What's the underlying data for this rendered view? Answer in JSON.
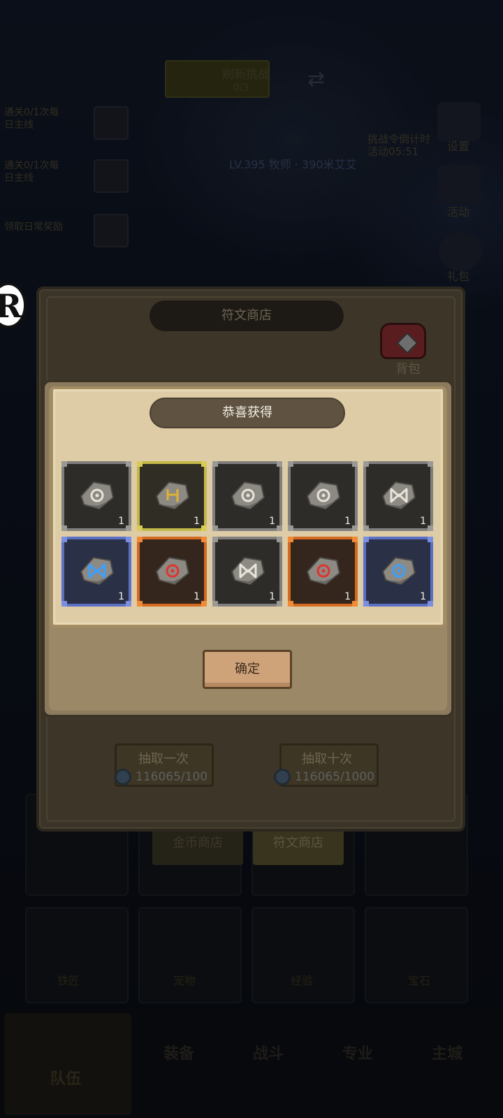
{
  "background": {
    "hp_text": "刷新挑战",
    "hp_sub": "0/3",
    "quests": [
      {
        "line1": "通关0/1次每",
        "line2": "日主线"
      },
      {
        "line1": "通关0/1次每",
        "line2": "日主线"
      },
      {
        "line1": "领取日常奖励",
        "line2": ""
      }
    ],
    "level_line": "LV.395 牧师 · 390米艾艾",
    "right_menu": [
      "设置",
      "活动",
      "礼包"
    ],
    "timer_text": "挑战令倒计时 活动05:51",
    "shop_tabs": [
      "金币商店",
      "符文商店"
    ],
    "equip_tabs": [
      "铁匠",
      "宠物",
      "经验",
      "宝石"
    ],
    "bottom_nav": [
      "队伍",
      "装备",
      "战斗",
      "专业",
      "主城"
    ]
  },
  "shop": {
    "title": "符文商店",
    "bag_label": "背包",
    "draw_once": {
      "label": "抽取一次",
      "cost": "116065/100"
    },
    "draw_ten": {
      "label": "抽取十次",
      "cost": "116065/1000"
    }
  },
  "dialog": {
    "title": "恭喜获得",
    "confirm_label": "确定",
    "rewards": [
      {
        "rarity": "gray",
        "glyph": "circle",
        "glyph_color": "#e8e4da",
        "qty": "1"
      },
      {
        "rarity": "gold",
        "glyph": "square",
        "glyph_color": "#e0b236",
        "qty": "1"
      },
      {
        "rarity": "gray",
        "glyph": "circle",
        "glyph_color": "#e8e4da",
        "qty": "1"
      },
      {
        "rarity": "gray",
        "glyph": "circle",
        "glyph_color": "#e8e4da",
        "qty": "1"
      },
      {
        "rarity": "gray",
        "glyph": "bowtie",
        "glyph_color": "#e8e4da",
        "qty": "1"
      },
      {
        "rarity": "blue",
        "glyph": "bowtie",
        "glyph_color": "#3aa0ff",
        "qty": "1"
      },
      {
        "rarity": "orange",
        "glyph": "circle",
        "glyph_color": "#e0342e",
        "qty": "1"
      },
      {
        "rarity": "gray",
        "glyph": "bowtie",
        "glyph_color": "#e8e4da",
        "qty": "1"
      },
      {
        "rarity": "orange",
        "glyph": "circle",
        "glyph_color": "#e0342e",
        "qty": "1"
      },
      {
        "rarity": "blue",
        "glyph": "circle",
        "glyph_color": "#3aa0ff",
        "qty": "1"
      }
    ]
  }
}
